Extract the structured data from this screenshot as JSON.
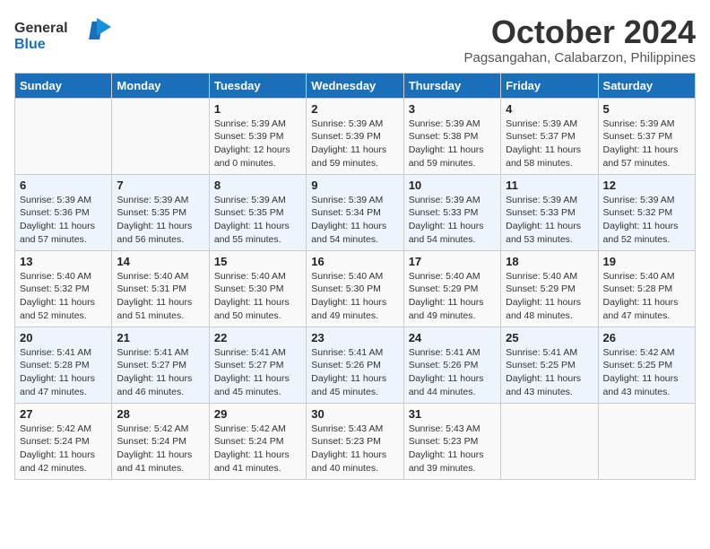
{
  "header": {
    "logo_general": "General",
    "logo_blue": "Blue",
    "month_title": "October 2024",
    "subtitle": "Pagsangahan, Calabarzon, Philippines"
  },
  "weekdays": [
    "Sunday",
    "Monday",
    "Tuesday",
    "Wednesday",
    "Thursday",
    "Friday",
    "Saturday"
  ],
  "weeks": [
    [
      {
        "day": "",
        "sunrise": "",
        "sunset": "",
        "daylight": ""
      },
      {
        "day": "",
        "sunrise": "",
        "sunset": "",
        "daylight": ""
      },
      {
        "day": "1",
        "sunrise": "Sunrise: 5:39 AM",
        "sunset": "Sunset: 5:39 PM",
        "daylight": "Daylight: 12 hours and 0 minutes."
      },
      {
        "day": "2",
        "sunrise": "Sunrise: 5:39 AM",
        "sunset": "Sunset: 5:39 PM",
        "daylight": "Daylight: 11 hours and 59 minutes."
      },
      {
        "day": "3",
        "sunrise": "Sunrise: 5:39 AM",
        "sunset": "Sunset: 5:38 PM",
        "daylight": "Daylight: 11 hours and 59 minutes."
      },
      {
        "day": "4",
        "sunrise": "Sunrise: 5:39 AM",
        "sunset": "Sunset: 5:37 PM",
        "daylight": "Daylight: 11 hours and 58 minutes."
      },
      {
        "day": "5",
        "sunrise": "Sunrise: 5:39 AM",
        "sunset": "Sunset: 5:37 PM",
        "daylight": "Daylight: 11 hours and 57 minutes."
      }
    ],
    [
      {
        "day": "6",
        "sunrise": "Sunrise: 5:39 AM",
        "sunset": "Sunset: 5:36 PM",
        "daylight": "Daylight: 11 hours and 57 minutes."
      },
      {
        "day": "7",
        "sunrise": "Sunrise: 5:39 AM",
        "sunset": "Sunset: 5:35 PM",
        "daylight": "Daylight: 11 hours and 56 minutes."
      },
      {
        "day": "8",
        "sunrise": "Sunrise: 5:39 AM",
        "sunset": "Sunset: 5:35 PM",
        "daylight": "Daylight: 11 hours and 55 minutes."
      },
      {
        "day": "9",
        "sunrise": "Sunrise: 5:39 AM",
        "sunset": "Sunset: 5:34 PM",
        "daylight": "Daylight: 11 hours and 54 minutes."
      },
      {
        "day": "10",
        "sunrise": "Sunrise: 5:39 AM",
        "sunset": "Sunset: 5:33 PM",
        "daylight": "Daylight: 11 hours and 54 minutes."
      },
      {
        "day": "11",
        "sunrise": "Sunrise: 5:39 AM",
        "sunset": "Sunset: 5:33 PM",
        "daylight": "Daylight: 11 hours and 53 minutes."
      },
      {
        "day": "12",
        "sunrise": "Sunrise: 5:39 AM",
        "sunset": "Sunset: 5:32 PM",
        "daylight": "Daylight: 11 hours and 52 minutes."
      }
    ],
    [
      {
        "day": "13",
        "sunrise": "Sunrise: 5:40 AM",
        "sunset": "Sunset: 5:32 PM",
        "daylight": "Daylight: 11 hours and 52 minutes."
      },
      {
        "day": "14",
        "sunrise": "Sunrise: 5:40 AM",
        "sunset": "Sunset: 5:31 PM",
        "daylight": "Daylight: 11 hours and 51 minutes."
      },
      {
        "day": "15",
        "sunrise": "Sunrise: 5:40 AM",
        "sunset": "Sunset: 5:30 PM",
        "daylight": "Daylight: 11 hours and 50 minutes."
      },
      {
        "day": "16",
        "sunrise": "Sunrise: 5:40 AM",
        "sunset": "Sunset: 5:30 PM",
        "daylight": "Daylight: 11 hours and 49 minutes."
      },
      {
        "day": "17",
        "sunrise": "Sunrise: 5:40 AM",
        "sunset": "Sunset: 5:29 PM",
        "daylight": "Daylight: 11 hours and 49 minutes."
      },
      {
        "day": "18",
        "sunrise": "Sunrise: 5:40 AM",
        "sunset": "Sunset: 5:29 PM",
        "daylight": "Daylight: 11 hours and 48 minutes."
      },
      {
        "day": "19",
        "sunrise": "Sunrise: 5:40 AM",
        "sunset": "Sunset: 5:28 PM",
        "daylight": "Daylight: 11 hours and 47 minutes."
      }
    ],
    [
      {
        "day": "20",
        "sunrise": "Sunrise: 5:41 AM",
        "sunset": "Sunset: 5:28 PM",
        "daylight": "Daylight: 11 hours and 47 minutes."
      },
      {
        "day": "21",
        "sunrise": "Sunrise: 5:41 AM",
        "sunset": "Sunset: 5:27 PM",
        "daylight": "Daylight: 11 hours and 46 minutes."
      },
      {
        "day": "22",
        "sunrise": "Sunrise: 5:41 AM",
        "sunset": "Sunset: 5:27 PM",
        "daylight": "Daylight: 11 hours and 45 minutes."
      },
      {
        "day": "23",
        "sunrise": "Sunrise: 5:41 AM",
        "sunset": "Sunset: 5:26 PM",
        "daylight": "Daylight: 11 hours and 45 minutes."
      },
      {
        "day": "24",
        "sunrise": "Sunrise: 5:41 AM",
        "sunset": "Sunset: 5:26 PM",
        "daylight": "Daylight: 11 hours and 44 minutes."
      },
      {
        "day": "25",
        "sunrise": "Sunrise: 5:41 AM",
        "sunset": "Sunset: 5:25 PM",
        "daylight": "Daylight: 11 hours and 43 minutes."
      },
      {
        "day": "26",
        "sunrise": "Sunrise: 5:42 AM",
        "sunset": "Sunset: 5:25 PM",
        "daylight": "Daylight: 11 hours and 43 minutes."
      }
    ],
    [
      {
        "day": "27",
        "sunrise": "Sunrise: 5:42 AM",
        "sunset": "Sunset: 5:24 PM",
        "daylight": "Daylight: 11 hours and 42 minutes."
      },
      {
        "day": "28",
        "sunrise": "Sunrise: 5:42 AM",
        "sunset": "Sunset: 5:24 PM",
        "daylight": "Daylight: 11 hours and 41 minutes."
      },
      {
        "day": "29",
        "sunrise": "Sunrise: 5:42 AM",
        "sunset": "Sunset: 5:24 PM",
        "daylight": "Daylight: 11 hours and 41 minutes."
      },
      {
        "day": "30",
        "sunrise": "Sunrise: 5:43 AM",
        "sunset": "Sunset: 5:23 PM",
        "daylight": "Daylight: 11 hours and 40 minutes."
      },
      {
        "day": "31",
        "sunrise": "Sunrise: 5:43 AM",
        "sunset": "Sunset: 5:23 PM",
        "daylight": "Daylight: 11 hours and 39 minutes."
      },
      {
        "day": "",
        "sunrise": "",
        "sunset": "",
        "daylight": ""
      },
      {
        "day": "",
        "sunrise": "",
        "sunset": "",
        "daylight": ""
      }
    ]
  ]
}
